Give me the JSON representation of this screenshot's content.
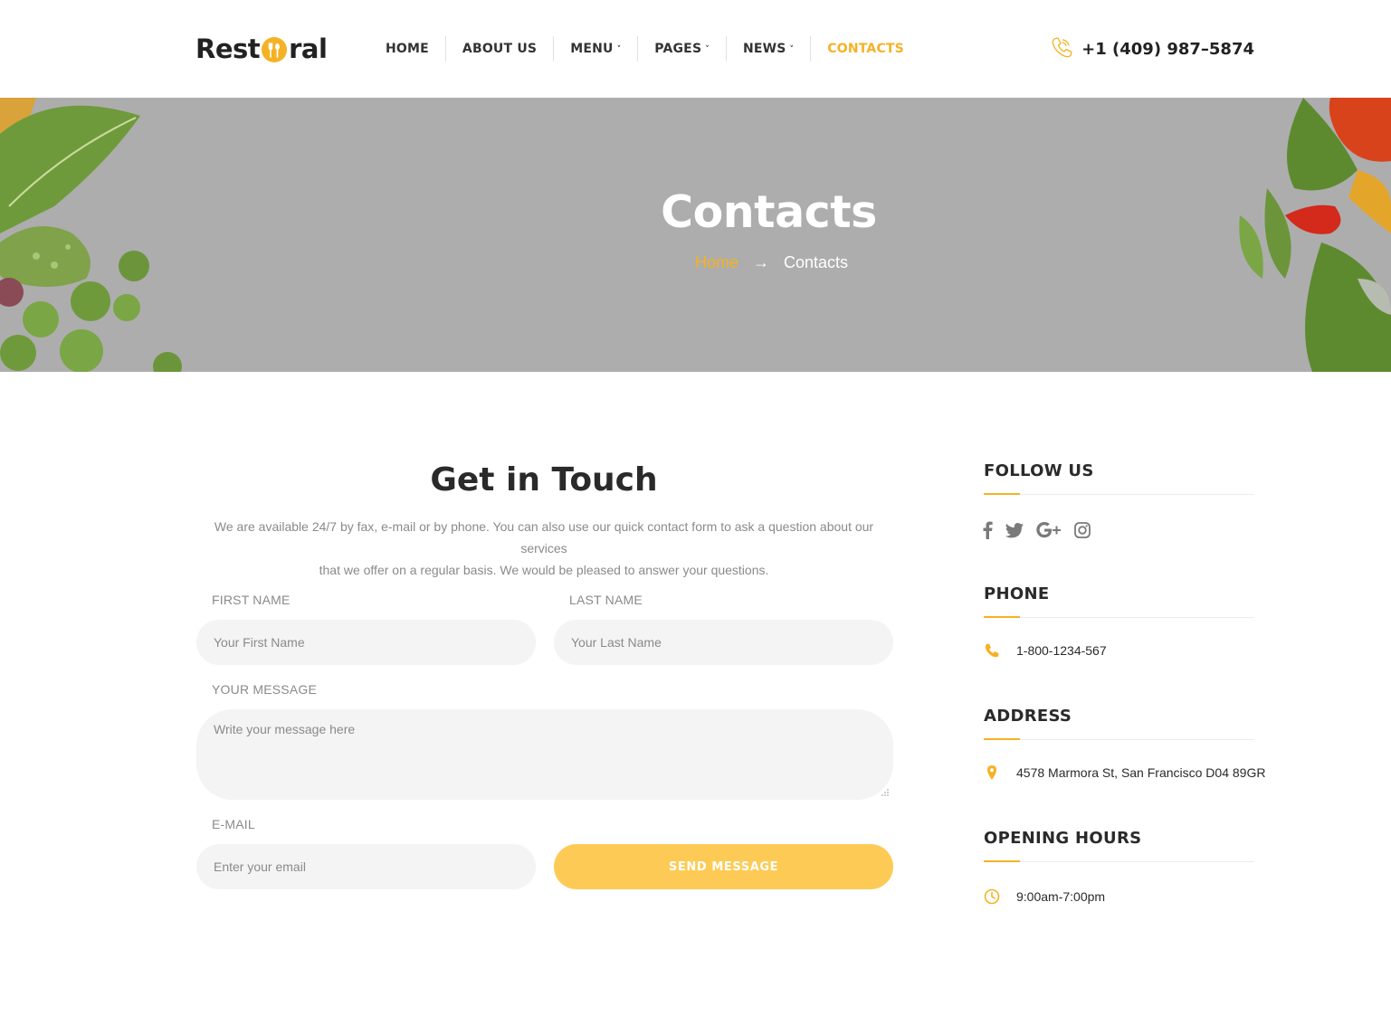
{
  "header": {
    "logo_left": "Rest",
    "logo_right": "ral",
    "nav": [
      {
        "label": "HOME",
        "dropdown": false,
        "active": false
      },
      {
        "label": "ABOUT US",
        "dropdown": false,
        "active": false
      },
      {
        "label": "MENU",
        "dropdown": true,
        "active": false
      },
      {
        "label": "PAGES",
        "dropdown": true,
        "active": false
      },
      {
        "label": "NEWS",
        "dropdown": true,
        "active": false
      },
      {
        "label": "CONTACTS",
        "dropdown": false,
        "active": true
      }
    ],
    "phone": "+1 (409) 987–5874",
    "phone_icon": "phone-icon"
  },
  "hero": {
    "title": "Contacts",
    "breadcrumb_home": "Home",
    "breadcrumb_current": "Contacts",
    "breadcrumb_arrow": "→"
  },
  "form": {
    "title": "Get in Touch",
    "description_line1": "We are available 24/7 by fax, e-mail or by phone. You can also use our quick contact form to ask a question about our services",
    "description_line2": "that we offer on a regular basis. We would be pleased to answer your questions.",
    "first_name_label": "FIRST NAME",
    "first_name_placeholder": "Your First Name",
    "last_name_label": "LAST NAME",
    "last_name_placeholder": "Your Last Name",
    "message_label": "YOUR MESSAGE",
    "message_placeholder": "Write your message here",
    "email_label": "E-MAIL",
    "email_placeholder": "Enter your email",
    "send_label": "SEND MESSAGE"
  },
  "sidebar": {
    "follow_title": "FOLLOW US",
    "social_icons": [
      "facebook-icon",
      "twitter-icon",
      "google-plus-icon",
      "instagram-icon"
    ],
    "phone_title": "PHONE",
    "phone_value": "1-800-1234-567",
    "address_title": "ADDRESS",
    "address_value": "4578 Marmora St, San Francisco D04 89GR",
    "hours_title": "OPENING HOURS",
    "hours_value": "9:00am-7:00pm"
  },
  "colors": {
    "accent": "#f5b225",
    "button": "#fdcb55",
    "hero_bg": "#adadad",
    "input_bg": "#f4f4f4",
    "muted_text": "#8a8a8a",
    "social_icon": "#7a7a7a"
  }
}
